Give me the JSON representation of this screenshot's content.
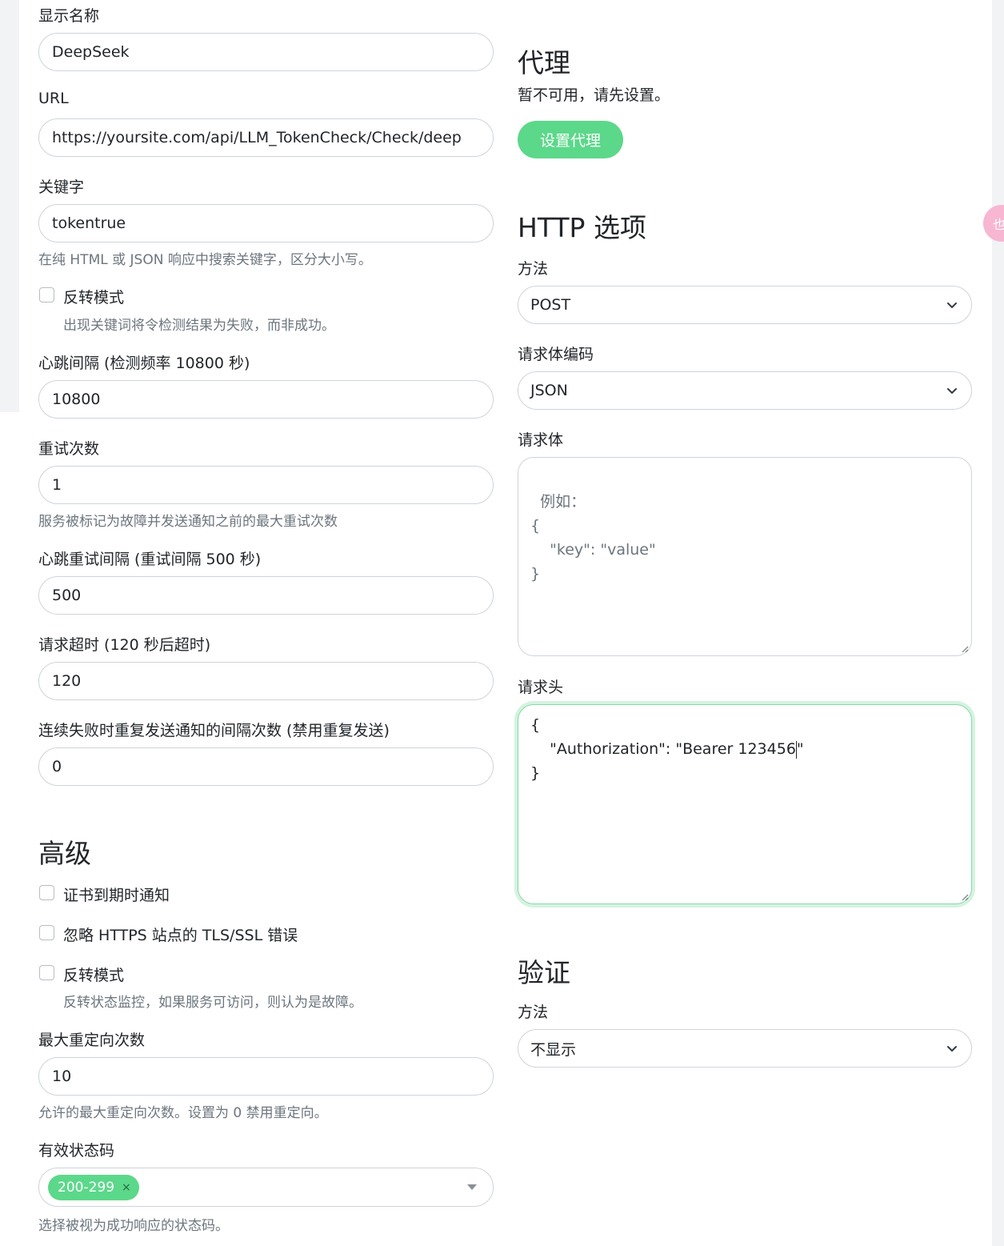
{
  "general": {
    "display_name_label": "显示名称",
    "display_name_value": "DeepSeek",
    "url_label": "URL",
    "url_value": "https://yoursite.com/api/LLM_TokenCheck/Check/deep",
    "keyword_label": "关键字",
    "keyword_value": "tokentrue",
    "keyword_help": "在纯 HTML 或 JSON 响应中搜索关键字，区分大小写。",
    "invert_keyword_label": "反转模式",
    "invert_keyword_help": "出现关键词将令检测结果为失败，而非成功。",
    "heartbeat_label": "心跳间隔 (检测频率 10800 秒)",
    "heartbeat_value": "10800",
    "retries_label": "重试次数",
    "retries_value": "1",
    "retries_help": "服务被标记为故障并发送通知之前的最大重试次数",
    "retry_interval_label": "心跳重试间隔 (重试间隔 500 秒)",
    "retry_interval_value": "500",
    "timeout_label": "请求超时 (120 秒后超时)",
    "timeout_value": "120",
    "resend_label": "连续失败时重复发送通知的间隔次数 (禁用重复发送)",
    "resend_value": "0"
  },
  "advanced": {
    "title": "高级",
    "cert_expiry_label": "证书到期时通知",
    "ignore_tls_label": "忽略 HTTPS 站点的 TLS/SSL 错误",
    "invert_mode_label": "反转模式",
    "invert_mode_help": "反转状态监控，如果服务可访问，则认为是故障。",
    "max_redirects_label": "最大重定向次数",
    "max_redirects_value": "10",
    "max_redirects_help": "允许的最大重定向次数。设置为 0 禁用重定向。",
    "accepted_codes_label": "有效状态码",
    "accepted_codes_tag": "200-299",
    "accepted_codes_tag_remove": "×",
    "accepted_codes_help": "选择被视为成功响应的状态码。"
  },
  "proxy": {
    "title": "代理",
    "unavailable_text": "暂不可用，请先设置。",
    "setup_button": "设置代理"
  },
  "http_options": {
    "title": "HTTP 选项",
    "method_label": "方法",
    "method_value": "POST",
    "body_encoding_label": "请求体编码",
    "body_encoding_value": "JSON",
    "body_label": "请求体",
    "body_placeholder": "例如：\n{\n    \"key\": \"value\"\n}",
    "headers_label": "请求头",
    "headers_line1": "{",
    "headers_line2a": "    \"Authorization\": \"Bearer 123456",
    "headers_line2b": "\"",
    "headers_line3": "}"
  },
  "auth": {
    "title": "验证",
    "method_label": "方法",
    "method_value": "不显示"
  },
  "floating_badge_text": "也",
  "colors": {
    "primary": "#5cd88a",
    "focus_border": "#89d9a4",
    "badge": "#f7b6d2"
  }
}
